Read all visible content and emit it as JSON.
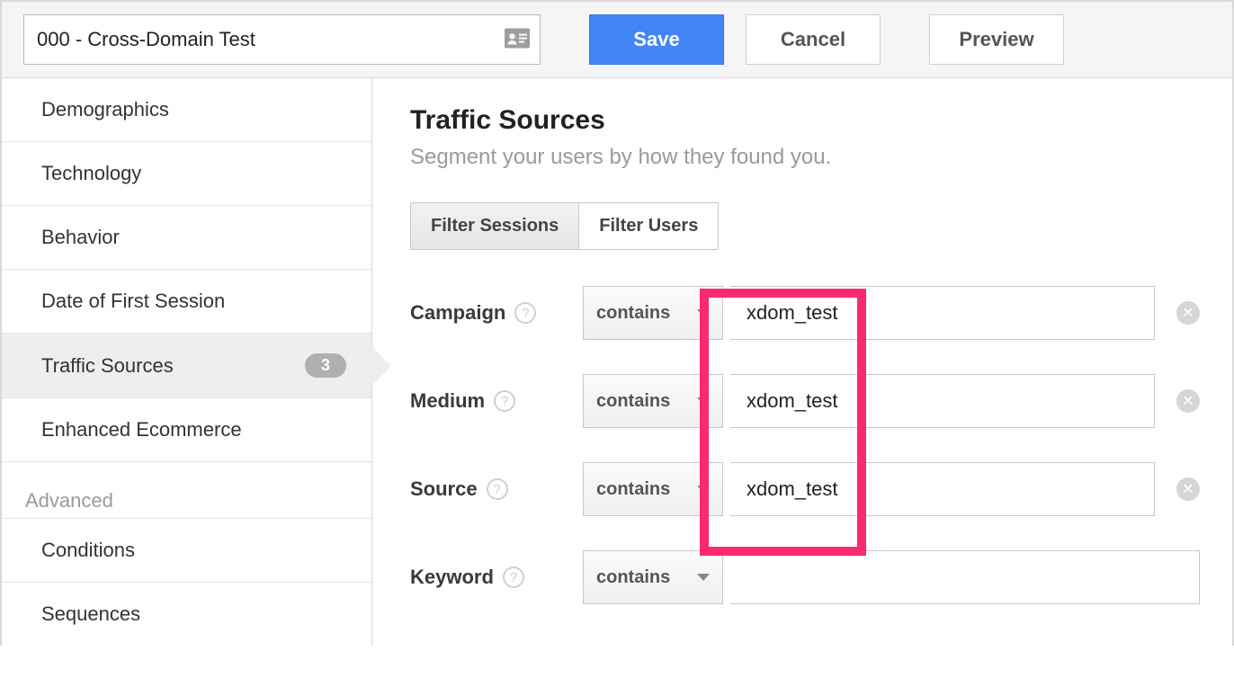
{
  "toolbar": {
    "segment_name": "000 - Cross-Domain Test",
    "save_label": "Save",
    "cancel_label": "Cancel",
    "preview_label": "Preview"
  },
  "sidebar": {
    "items": [
      {
        "label": "Demographics",
        "active": false,
        "badge": null
      },
      {
        "label": "Technology",
        "active": false,
        "badge": null
      },
      {
        "label": "Behavior",
        "active": false,
        "badge": null
      },
      {
        "label": "Date of First Session",
        "active": false,
        "badge": null
      },
      {
        "label": "Traffic Sources",
        "active": true,
        "badge": "3"
      },
      {
        "label": "Enhanced Ecommerce",
        "active": false,
        "badge": null
      }
    ],
    "advanced_label": "Advanced",
    "advanced_items": [
      {
        "label": "Conditions"
      },
      {
        "label": "Sequences"
      }
    ]
  },
  "main": {
    "title": "Traffic Sources",
    "subtitle": "Segment your users by how they found you.",
    "filter_tabs": {
      "sessions": "Filter Sessions",
      "users": "Filter Users"
    },
    "fields": [
      {
        "label": "Campaign",
        "operator": "contains",
        "value": "xdom_test",
        "clearable": true
      },
      {
        "label": "Medium",
        "operator": "contains",
        "value": "xdom_test",
        "clearable": true
      },
      {
        "label": "Source",
        "operator": "contains",
        "value": "xdom_test",
        "clearable": true
      },
      {
        "label": "Keyword",
        "operator": "contains",
        "value": "",
        "clearable": false
      }
    ]
  },
  "colors": {
    "primary": "#4285f4",
    "highlight": "#fa2a72"
  }
}
